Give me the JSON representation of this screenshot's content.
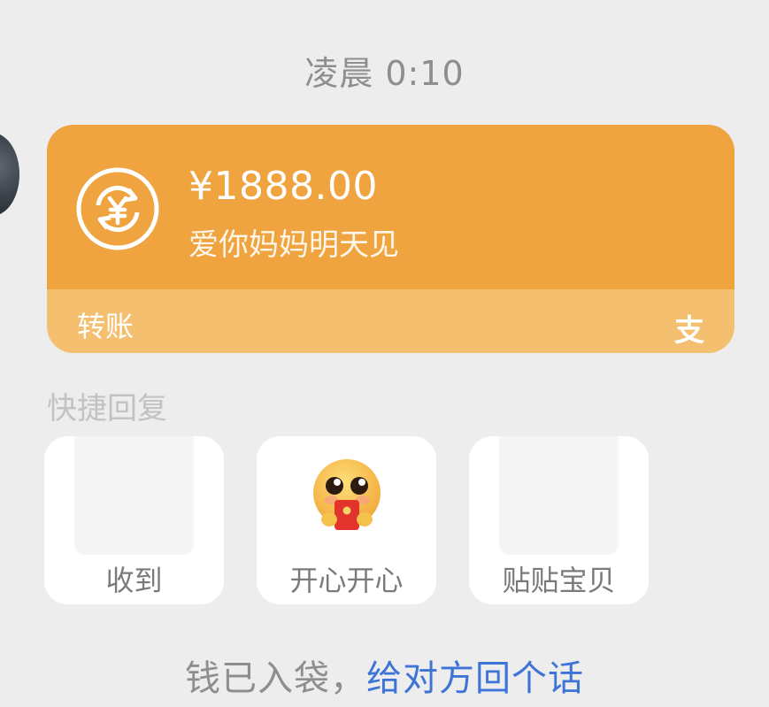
{
  "timestamp": "凌晨 0:10",
  "transfer": {
    "amount": "¥1888.00",
    "note": "爱你妈妈明天见",
    "type_label": "转账",
    "brand_icon_glyph": "支",
    "icon": "transfer-currency-icon",
    "colors": {
      "top": "#f0a43f",
      "bottom": "#f4bf6f"
    }
  },
  "quick_reply": {
    "title": "快捷回复",
    "items": [
      {
        "label": "收到"
      },
      {
        "label": "开心开心"
      },
      {
        "label": "贴贴宝贝"
      }
    ]
  },
  "footer": {
    "status_text": "钱已入袋，",
    "action_text": "给对方回个话",
    "action_color": "#3d74d6"
  }
}
